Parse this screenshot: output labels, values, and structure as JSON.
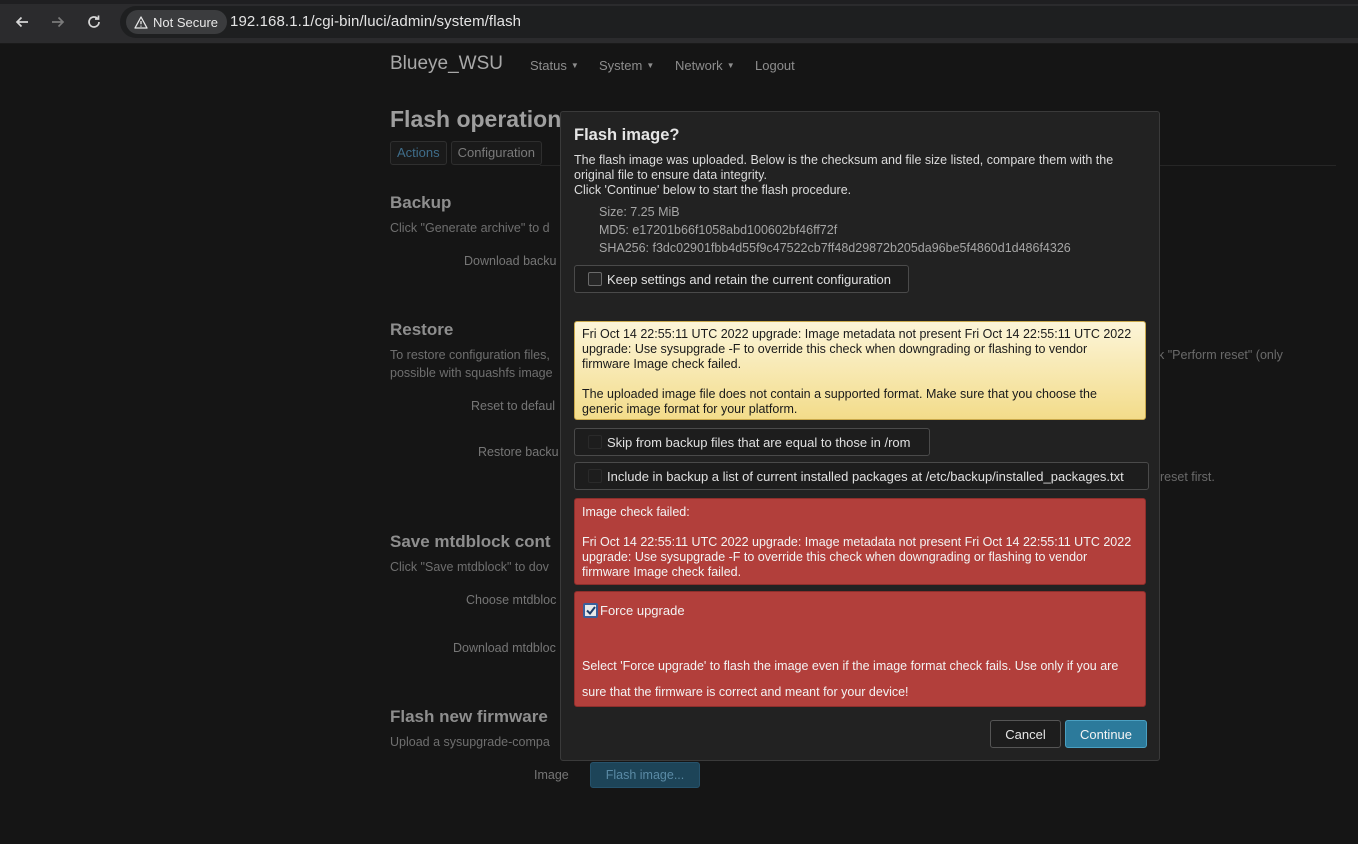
{
  "browser": {
    "security_label": "Not Secure",
    "url": "192.168.1.1/cgi-bin/luci/admin/system/flash"
  },
  "page": {
    "brand": "Blueye_WSU",
    "nav": [
      "Status",
      "System",
      "Network",
      "Logout"
    ],
    "title": "Flash operation",
    "tabs": [
      "Actions",
      "Configuration"
    ],
    "backup": {
      "heading": "Backup",
      "text": "Click \"Generate archive\" to d",
      "download_label": "Download backu"
    },
    "restore": {
      "heading": "Restore",
      "text_line1": "To restore configuration files,",
      "text_line2": "possible with squashfs image",
      "text_right": "k \"Perform reset\" (only",
      "reset_label": "Reset to defaul",
      "restore_label": "Restore backu",
      "restore_right": "reset first."
    },
    "mtdblock": {
      "heading": "Save mtdblock cont",
      "text": "Click \"Save mtdblock\" to dov",
      "choose_label": "Choose mtdbloc",
      "download_label": "Download mtdbloc"
    },
    "flash": {
      "heading": "Flash new firmware",
      "text": "Upload a sysupgrade-compa",
      "image_label": "Image",
      "image_button": "Flash image..."
    }
  },
  "modal": {
    "title": "Flash image?",
    "desc_line1": "The flash image was uploaded. Below is the checksum and file size listed, compare them with the original file to ensure data integrity.",
    "desc_line2": "Click 'Continue' below to start the flash procedure.",
    "size": "Size: 7.25 MiB",
    "md5": "MD5: e17201b66f1058abd100602bf46ff72f",
    "sha256": "SHA256: f3dc02901fbb4d55f9c47522cb7ff48d29872b205da96be5f4860d1d486f4326",
    "keep_settings": "Keep settings and retain the current configuration",
    "warning_p1": "Fri Oct 14 22:55:11 UTC 2022 upgrade: Image metadata not present Fri Oct 14 22:55:11 UTC 2022 upgrade: Use sysupgrade -F to override this check when downgrading or flashing to vendor firmware Image check failed.",
    "warning_p2": "The uploaded image file does not contain a supported format. Make sure that you choose the generic image format for your platform.",
    "skip_backup": "Skip from backup files that are equal to those in /rom",
    "include_packages": "Include in backup a list of current installed packages at /etc/backup/installed_packages.txt",
    "error_heading": "Image check failed:",
    "error_text": "Fri Oct 14 22:55:11 UTC 2022 upgrade: Image metadata not present Fri Oct 14 22:55:11 UTC 2022 upgrade: Use sysupgrade -F to override this check when downgrading or flashing to vendor firmware Image check failed.",
    "force_label": "Force upgrade",
    "force_checked": true,
    "force_help": "Select 'Force upgrade' to flash the image even if the image format check fails. Use only if you are sure that the firmware is correct and meant for your device!",
    "cancel": "Cancel",
    "continue": "Continue"
  }
}
